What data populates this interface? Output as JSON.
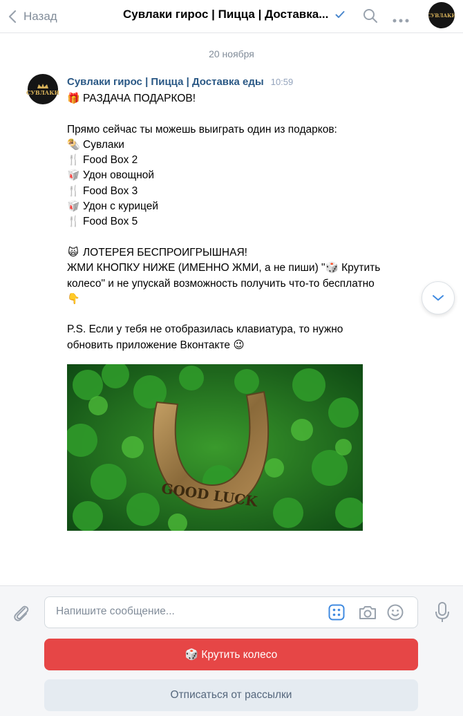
{
  "header": {
    "back_label": "Назад",
    "title": "Сувлаки гирос | Пицца | Доставка...",
    "logo_text": "СУВЛАКИ"
  },
  "date_divider": "20 ноября",
  "message": {
    "sender": "Сувлаки гирос | Пицца | Доставка еды",
    "time": "10:59",
    "lines": [
      {
        "emoji": "🎁",
        "text": "РАЗДАЧА ПОДАРКОВ!"
      },
      {
        "emoji": "",
        "text": ""
      },
      {
        "emoji": "",
        "text": "Прямо сейчас ты можешь выиграть один из подарков:"
      },
      {
        "emoji": "🌯",
        "text": "Сувлаки"
      },
      {
        "emoji": "🍴",
        "text": "Food Box 2"
      },
      {
        "emoji": "🥡",
        "text": "Удон овощной"
      },
      {
        "emoji": "🍴",
        "text": "Food Box 3"
      },
      {
        "emoji": "🥡",
        "text": "Удон с курицей"
      },
      {
        "emoji": "🍴",
        "text": "Food Box 5"
      },
      {
        "emoji": "",
        "text": ""
      },
      {
        "emoji": "🙀",
        "text": "ЛОТЕРЕЯ БЕСПРОИГРЫШНАЯ!"
      },
      {
        "emoji": "",
        "text": "ЖМИ КНОПКУ НИЖЕ (ИМЕННО ЖМИ, а не пиши) \"🎲 Крутить"
      },
      {
        "emoji": "",
        "text": "колесо\" и не упускай возможность получить что-то бесплатно"
      },
      {
        "emoji": "👇",
        "text": ""
      },
      {
        "emoji": "",
        "text": ""
      },
      {
        "emoji": "",
        "text": "P.S. Если у тебя не отобразилась клавиатура, то нужно"
      },
      {
        "emoji": "",
        "text": "обновить приложение Вконтакте 😉"
      }
    ],
    "photo_text": "GOOD LUCK"
  },
  "composer": {
    "placeholder": "Напишите сообщение..."
  },
  "keyboard": {
    "spin_button": "🎲 Крутить колесо",
    "unsubscribe_button": "Отписаться от рассылки"
  },
  "colors": {
    "accent_red": "#e64646",
    "link_blue": "#2a5885",
    "icon_blue": "#3f8ae0",
    "muted": "#818c99"
  },
  "icons": [
    "chevron-left-icon",
    "verified-check-icon",
    "search-icon",
    "more-icon",
    "chevron-down-icon",
    "paperclip-icon",
    "bot-keyboard-icon",
    "camera-icon",
    "smile-icon",
    "microphone-icon"
  ]
}
